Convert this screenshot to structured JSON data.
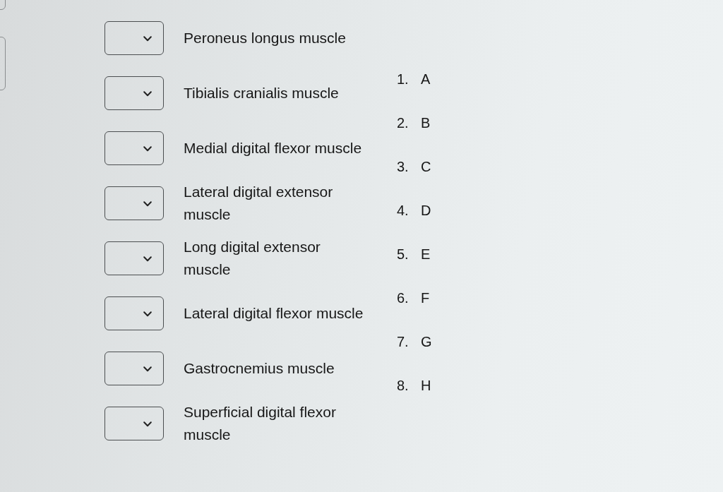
{
  "matching": {
    "items": [
      {
        "label": "Peroneus longus muscle"
      },
      {
        "label": "Tibialis cranialis muscle"
      },
      {
        "label": "Medial digital flexor muscle"
      },
      {
        "label": "Lateral digital extensor muscle"
      },
      {
        "label": "Long digital extensor muscle"
      },
      {
        "label": "Lateral digital flexor muscle"
      },
      {
        "label": "Gastrocnemius muscle"
      },
      {
        "label": "Superficial digital flexor muscle"
      }
    ],
    "options": [
      {
        "number": "1.",
        "letter": "A"
      },
      {
        "number": "2.",
        "letter": "B"
      },
      {
        "number": "3.",
        "letter": "C"
      },
      {
        "number": "4.",
        "letter": "D"
      },
      {
        "number": "5.",
        "letter": "E"
      },
      {
        "number": "6.",
        "letter": "F"
      },
      {
        "number": "7.",
        "letter": "G"
      },
      {
        "number": "8.",
        "letter": "H"
      }
    ]
  }
}
